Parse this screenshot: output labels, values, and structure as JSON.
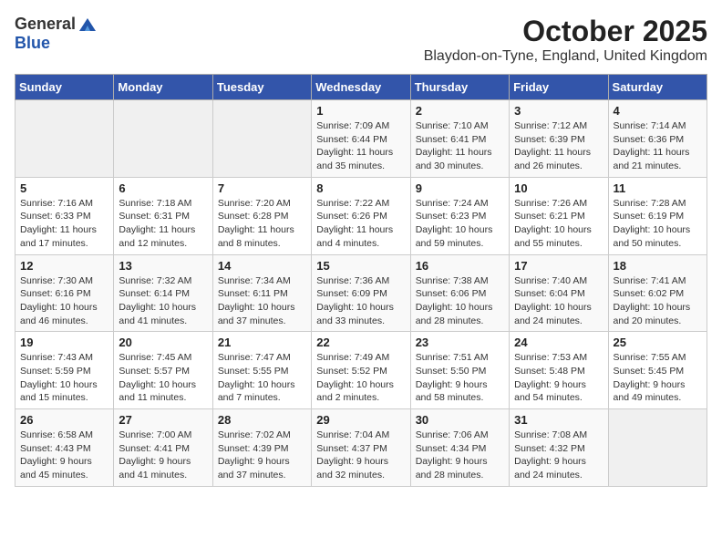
{
  "header": {
    "logo_line1": "General",
    "logo_line2": "Blue",
    "month": "October 2025",
    "location": "Blaydon-on-Tyne, England, United Kingdom"
  },
  "weekdays": [
    "Sunday",
    "Monday",
    "Tuesday",
    "Wednesday",
    "Thursday",
    "Friday",
    "Saturday"
  ],
  "weeks": [
    [
      {
        "day": "",
        "info": ""
      },
      {
        "day": "",
        "info": ""
      },
      {
        "day": "",
        "info": ""
      },
      {
        "day": "1",
        "info": "Sunrise: 7:09 AM\nSunset: 6:44 PM\nDaylight: 11 hours\nand 35 minutes."
      },
      {
        "day": "2",
        "info": "Sunrise: 7:10 AM\nSunset: 6:41 PM\nDaylight: 11 hours\nand 30 minutes."
      },
      {
        "day": "3",
        "info": "Sunrise: 7:12 AM\nSunset: 6:39 PM\nDaylight: 11 hours\nand 26 minutes."
      },
      {
        "day": "4",
        "info": "Sunrise: 7:14 AM\nSunset: 6:36 PM\nDaylight: 11 hours\nand 21 minutes."
      }
    ],
    [
      {
        "day": "5",
        "info": "Sunrise: 7:16 AM\nSunset: 6:33 PM\nDaylight: 11 hours\nand 17 minutes."
      },
      {
        "day": "6",
        "info": "Sunrise: 7:18 AM\nSunset: 6:31 PM\nDaylight: 11 hours\nand 12 minutes."
      },
      {
        "day": "7",
        "info": "Sunrise: 7:20 AM\nSunset: 6:28 PM\nDaylight: 11 hours\nand 8 minutes."
      },
      {
        "day": "8",
        "info": "Sunrise: 7:22 AM\nSunset: 6:26 PM\nDaylight: 11 hours\nand 4 minutes."
      },
      {
        "day": "9",
        "info": "Sunrise: 7:24 AM\nSunset: 6:23 PM\nDaylight: 10 hours\nand 59 minutes."
      },
      {
        "day": "10",
        "info": "Sunrise: 7:26 AM\nSunset: 6:21 PM\nDaylight: 10 hours\nand 55 minutes."
      },
      {
        "day": "11",
        "info": "Sunrise: 7:28 AM\nSunset: 6:19 PM\nDaylight: 10 hours\nand 50 minutes."
      }
    ],
    [
      {
        "day": "12",
        "info": "Sunrise: 7:30 AM\nSunset: 6:16 PM\nDaylight: 10 hours\nand 46 minutes."
      },
      {
        "day": "13",
        "info": "Sunrise: 7:32 AM\nSunset: 6:14 PM\nDaylight: 10 hours\nand 41 minutes."
      },
      {
        "day": "14",
        "info": "Sunrise: 7:34 AM\nSunset: 6:11 PM\nDaylight: 10 hours\nand 37 minutes."
      },
      {
        "day": "15",
        "info": "Sunrise: 7:36 AM\nSunset: 6:09 PM\nDaylight: 10 hours\nand 33 minutes."
      },
      {
        "day": "16",
        "info": "Sunrise: 7:38 AM\nSunset: 6:06 PM\nDaylight: 10 hours\nand 28 minutes."
      },
      {
        "day": "17",
        "info": "Sunrise: 7:40 AM\nSunset: 6:04 PM\nDaylight: 10 hours\nand 24 minutes."
      },
      {
        "day": "18",
        "info": "Sunrise: 7:41 AM\nSunset: 6:02 PM\nDaylight: 10 hours\nand 20 minutes."
      }
    ],
    [
      {
        "day": "19",
        "info": "Sunrise: 7:43 AM\nSunset: 5:59 PM\nDaylight: 10 hours\nand 15 minutes."
      },
      {
        "day": "20",
        "info": "Sunrise: 7:45 AM\nSunset: 5:57 PM\nDaylight: 10 hours\nand 11 minutes."
      },
      {
        "day": "21",
        "info": "Sunrise: 7:47 AM\nSunset: 5:55 PM\nDaylight: 10 hours\nand 7 minutes."
      },
      {
        "day": "22",
        "info": "Sunrise: 7:49 AM\nSunset: 5:52 PM\nDaylight: 10 hours\nand 2 minutes."
      },
      {
        "day": "23",
        "info": "Sunrise: 7:51 AM\nSunset: 5:50 PM\nDaylight: 9 hours\nand 58 minutes."
      },
      {
        "day": "24",
        "info": "Sunrise: 7:53 AM\nSunset: 5:48 PM\nDaylight: 9 hours\nand 54 minutes."
      },
      {
        "day": "25",
        "info": "Sunrise: 7:55 AM\nSunset: 5:45 PM\nDaylight: 9 hours\nand 49 minutes."
      }
    ],
    [
      {
        "day": "26",
        "info": "Sunrise: 6:58 AM\nSunset: 4:43 PM\nDaylight: 9 hours\nand 45 minutes."
      },
      {
        "day": "27",
        "info": "Sunrise: 7:00 AM\nSunset: 4:41 PM\nDaylight: 9 hours\nand 41 minutes."
      },
      {
        "day": "28",
        "info": "Sunrise: 7:02 AM\nSunset: 4:39 PM\nDaylight: 9 hours\nand 37 minutes."
      },
      {
        "day": "29",
        "info": "Sunrise: 7:04 AM\nSunset: 4:37 PM\nDaylight: 9 hours\nand 32 minutes."
      },
      {
        "day": "30",
        "info": "Sunrise: 7:06 AM\nSunset: 4:34 PM\nDaylight: 9 hours\nand 28 minutes."
      },
      {
        "day": "31",
        "info": "Sunrise: 7:08 AM\nSunset: 4:32 PM\nDaylight: 9 hours\nand 24 minutes."
      },
      {
        "day": "",
        "info": ""
      }
    ]
  ]
}
